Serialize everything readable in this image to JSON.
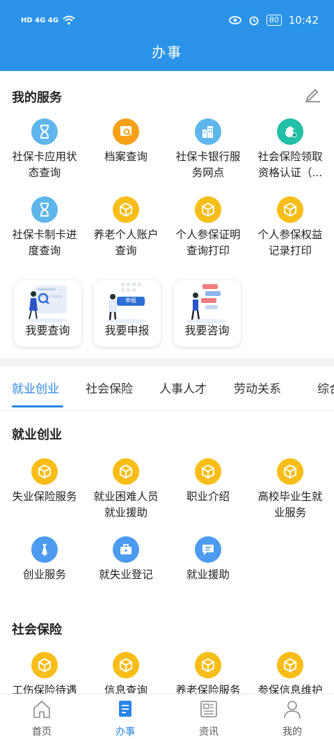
{
  "status_bar": {
    "time": "10:42",
    "battery": "80",
    "network_left": "HD 4G 4G",
    "colors": {
      "bar": "#2a93e8"
    }
  },
  "header": {
    "title": "办事"
  },
  "my_services": {
    "title": "我的服务",
    "edit_icon": "edit-icon",
    "items": [
      {
        "label": "社保卡应用状\n态查询",
        "icon": "hourglass-icon",
        "color": "#5fb6ec"
      },
      {
        "label": "档案查询",
        "icon": "archive-search-icon",
        "color": "#f6a019"
      },
      {
        "label": "社保卡银行服\n务网点",
        "icon": "bank-buildings-icon",
        "color": "#5fb6ec"
      },
      {
        "label": "社会保险领取\n资格认证（...",
        "icon": "face-verify-icon",
        "color": "#22c0a7"
      },
      {
        "label": "社保卡制卡进\n度查询",
        "icon": "hourglass-icon",
        "color": "#5fb6ec"
      },
      {
        "label": "养老个人账户\n查询",
        "icon": "cube-icon",
        "color": "#f8bd17"
      },
      {
        "label": "个人参保证明\n查询打印",
        "icon": "cube-icon",
        "color": "#f8bd17"
      },
      {
        "label": "个人参保权益\n记录打印",
        "icon": "cube-icon",
        "color": "#f8bd17"
      }
    ],
    "quick": [
      {
        "label": "我要查询",
        "icon": "query-illustration-icon"
      },
      {
        "label": "我要申报",
        "icon": "declare-illustration-icon",
        "badge": "申报"
      },
      {
        "label": "我要咨询",
        "icon": "consult-illustration-icon"
      }
    ]
  },
  "tabs": {
    "items": [
      "就业创业",
      "社会保险",
      "人事人才",
      "劳动关系",
      "综合"
    ],
    "active_color": "#2a86e6"
  },
  "employment": {
    "title": "就业创业",
    "items": [
      {
        "label": "失业保险服务",
        "icon": "cube-icon",
        "color": "#f8bd17"
      },
      {
        "label": "就业困难人员\n就业援助",
        "icon": "cube-icon",
        "color": "#f8bd17"
      },
      {
        "label": "职业介绍",
        "icon": "cube-icon",
        "color": "#f8bd17"
      },
      {
        "label": "高校毕业生就\n业服务",
        "icon": "cube-icon",
        "color": "#f8bd17"
      },
      {
        "label": "创业服务",
        "icon": "tie-icon",
        "color": "#4c9bf0"
      },
      {
        "label": "就失业登记",
        "icon": "briefcase-icon",
        "color": "#4c9bf0"
      },
      {
        "label": "就业援助",
        "icon": "chat-doc-icon",
        "color": "#4c9bf0"
      }
    ]
  },
  "social_insurance": {
    "title": "社会保险",
    "items": [
      {
        "label": "工伤保险待遇",
        "icon": "cube-icon",
        "color": "#f8bd17"
      },
      {
        "label": "信息查询",
        "icon": "cube-icon",
        "color": "#f8bd17"
      },
      {
        "label": "养老保险服务",
        "icon": "cube-icon",
        "color": "#f8bd17"
      },
      {
        "label": "参保信息维护",
        "icon": "cube-icon",
        "color": "#f8bd17"
      }
    ]
  },
  "bottom_nav": {
    "items": [
      {
        "label": "首页",
        "icon": "home-icon"
      },
      {
        "label": "办事",
        "icon": "service-doc-icon"
      },
      {
        "label": "资讯",
        "icon": "news-icon"
      },
      {
        "label": "我的",
        "icon": "profile-icon"
      }
    ]
  }
}
